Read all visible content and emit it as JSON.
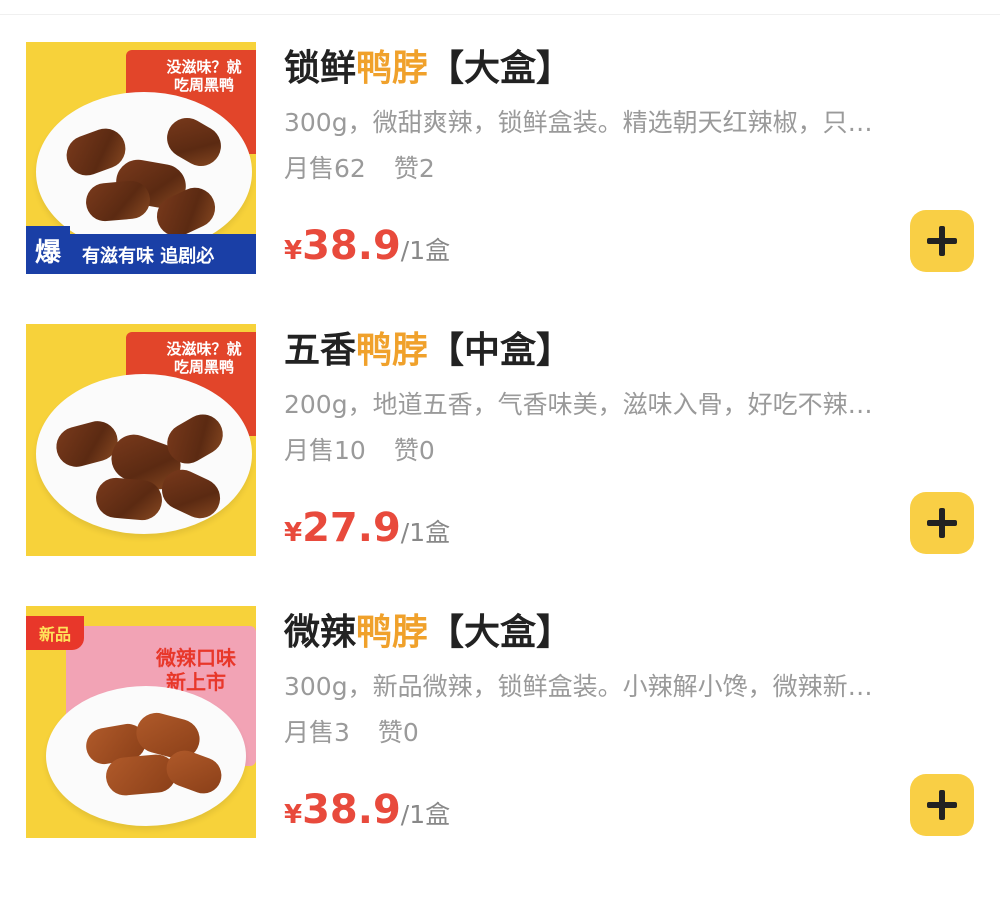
{
  "products": [
    {
      "title_prefix": "锁鲜",
      "title_highlight": "鸭脖",
      "title_suffix": "【大盒】",
      "description": "300g，微甜爽辣，锁鲜盒装。精选朝天红辣椒，只…",
      "sales": "月售62",
      "likes": "赞2",
      "currency": "¥",
      "price": "38.9",
      "unit": "/1盒",
      "image": {
        "package_text": "没滋味？就吃周黑鸭",
        "banner_text": "有滋有味 追剧必",
        "badge": "爆"
      }
    },
    {
      "title_prefix": "五香",
      "title_highlight": "鸭脖",
      "title_suffix": "【中盒】",
      "description": "200g，地道五香，气香味美，滋味入骨，好吃不辣…",
      "sales": "月售10",
      "likes": "赞0",
      "currency": "¥",
      "price": "27.9",
      "unit": "/1盒",
      "image": {
        "package_text": "没滋味？就吃周黑鸭"
      }
    },
    {
      "title_prefix": "微辣",
      "title_highlight": "鸭脖",
      "title_suffix": "【大盒】",
      "description": "300g，新品微辣，锁鲜盒装。小辣解小馋，微辣新…",
      "sales": "月售3",
      "likes": "赞0",
      "currency": "¥",
      "price": "38.9",
      "unit": "/1盒",
      "image": {
        "badge": "新品",
        "package_text": "微辣口味 新上市"
      }
    }
  ],
  "icons": {
    "add": "plus-icon"
  },
  "colors": {
    "highlight": "#f0a12b",
    "price": "#e84a3c",
    "add_button": "#f9cf45",
    "thumb_bg": "#f7d23a"
  }
}
